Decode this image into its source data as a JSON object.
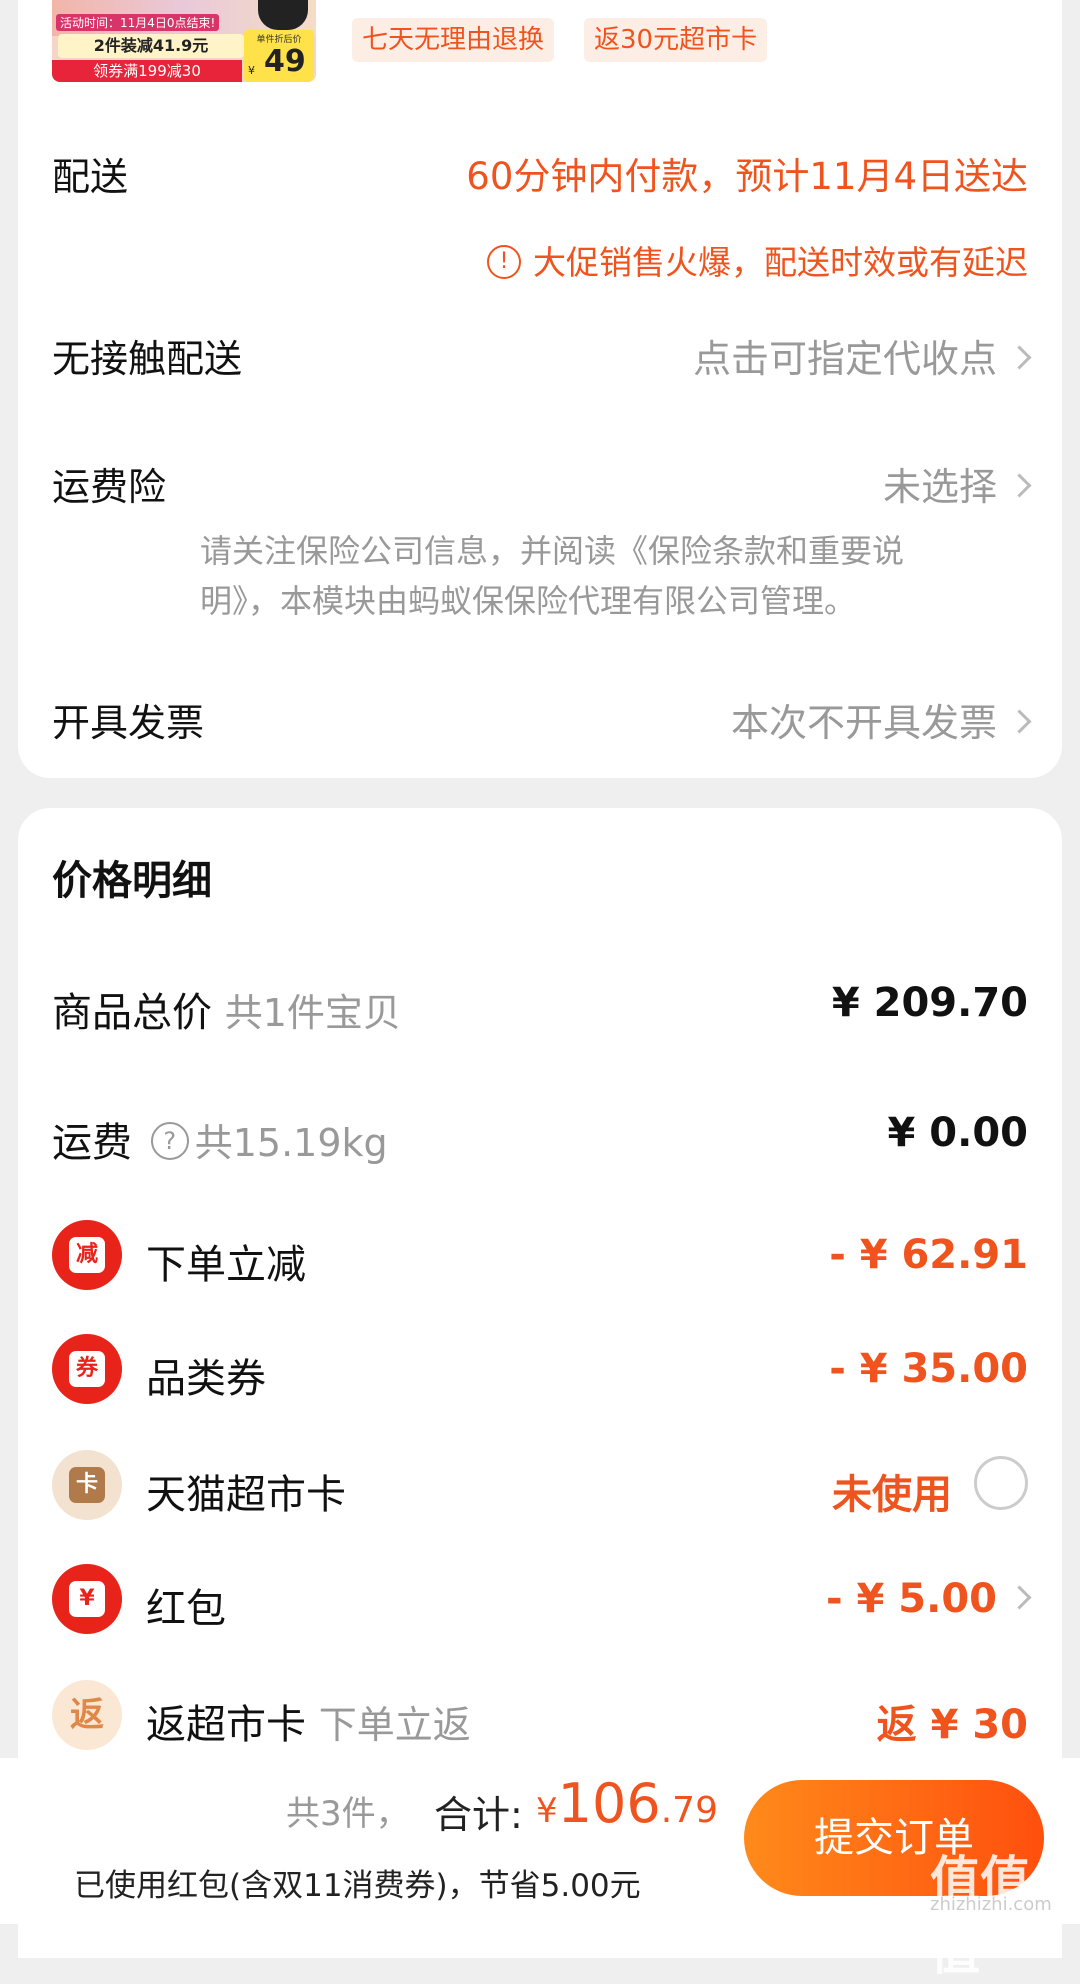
{
  "product": {
    "image_caption_top": "活动时间：11月4日0点结束!",
    "image_deal": "2件装减41.9元",
    "image_coupon": "领券满199减30",
    "image_price_caption": "单件折后价",
    "image_price_currency": "¥",
    "image_price": "49",
    "badges": [
      "七天无理由退换",
      "返30元超市卡"
    ]
  },
  "delivery": {
    "label": "配送",
    "value": "60分钟内付款，预计11月4日送达",
    "notice_icon": "!",
    "notice": "大促销售火爆，配送时效或有延迟"
  },
  "contactless": {
    "label": "无接触配送",
    "value": "点击可指定代收点"
  },
  "shipping_insurance": {
    "label": "运费险",
    "value": "未选择",
    "note_line1": "请关注保险公司信息，并阅读《保险条款和重要说",
    "note_line2": "明》，本模块由蚂蚁保保险代理有限公司管理。"
  },
  "invoice": {
    "label": "开具发票",
    "value": "本次不开具发票"
  },
  "price_detail": {
    "title": "价格明细",
    "total": {
      "label": "商品总价",
      "sub": "共1件宝贝",
      "value": "¥ 209.70"
    },
    "shipping": {
      "label": "运费",
      "help_icon": "?",
      "sub": "共15.19kg",
      "value": "¥ 0.00"
    },
    "items": [
      {
        "icon": "减",
        "label": "下单立减",
        "value": "- ¥ 62.91",
        "color": "#e8241a"
      },
      {
        "icon": "券",
        "label": "品类券",
        "value": "- ¥ 35.00",
        "color": "#e8241a"
      },
      {
        "icon": "卡",
        "label": "天猫超市卡",
        "value": "未使用",
        "color": "#f2e2cf"
      },
      {
        "icon": "¥",
        "label": "红包",
        "value": "- ¥ 5.00",
        "color": "#e8241a"
      },
      {
        "icon": "返",
        "label": "返超市卡",
        "sub": "下单立返",
        "value": "返 ¥ 30",
        "color": "#fbe8d4"
      }
    ]
  },
  "footer": {
    "count": "共3件，",
    "total_label": "合计:",
    "currency": "¥",
    "total_int": "106",
    "total_dec": ".79",
    "savings": "已使用红包(含双11消费券)，节省5.00元",
    "submit": "提交订单",
    "watermark": "值值值",
    "watermark_url": "zhizhizhi.com"
  }
}
